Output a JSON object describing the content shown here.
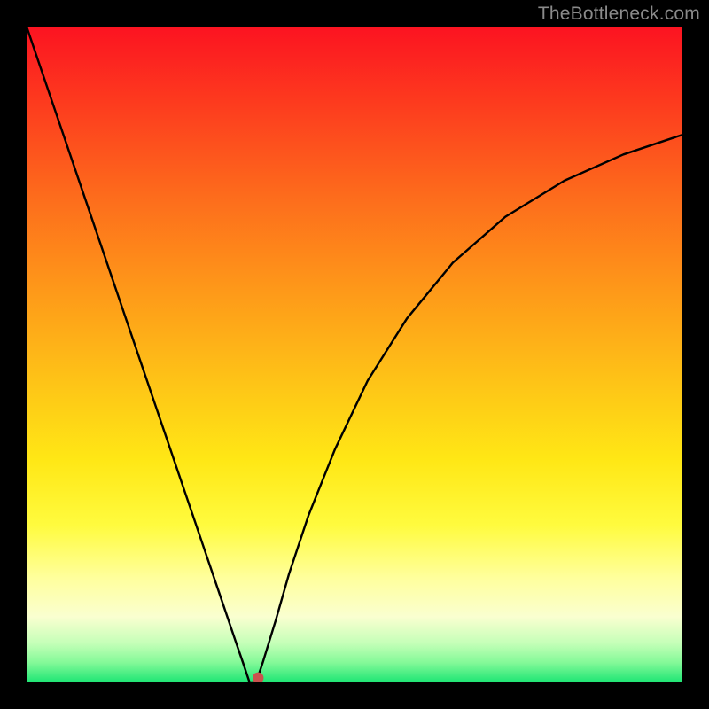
{
  "watermark": "TheBottleneck.com",
  "chart_data": {
    "type": "line",
    "title": "",
    "xlabel": "",
    "ylabel": "",
    "xlim": [
      0,
      100
    ],
    "ylim": [
      0,
      100
    ],
    "notch": {
      "x": 34,
      "y": 0
    },
    "marker": {
      "x": 35.3,
      "y": 0.7
    },
    "series": [
      {
        "name": "curve",
        "x": [
          0,
          5,
          10,
          15,
          20,
          25,
          30,
          32,
          33,
          34,
          35,
          36,
          38,
          40,
          43,
          47,
          52,
          58,
          65,
          73,
          82,
          91,
          100
        ],
        "values": [
          100,
          85.3,
          70.6,
          55.9,
          41.2,
          26.5,
          11.8,
          5.9,
          3.0,
          0,
          0,
          3.0,
          9.5,
          16.5,
          25.5,
          35.5,
          46.0,
          55.5,
          64.0,
          71.0,
          76.5,
          80.5,
          83.5
        ]
      }
    ]
  }
}
